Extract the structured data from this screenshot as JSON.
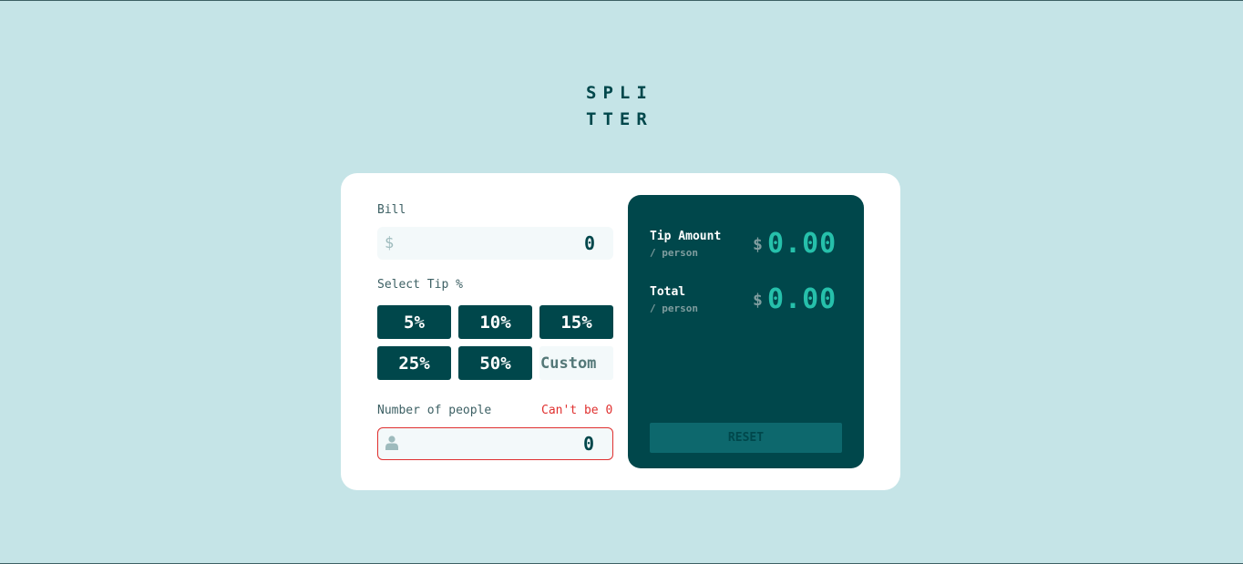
{
  "logo": {
    "line1": "SPLI",
    "line2": "TTER"
  },
  "bill": {
    "label": "Bill",
    "currency_symbol": "$",
    "value": "0"
  },
  "tip": {
    "label": "Select Tip %",
    "options": [
      "5%",
      "10%",
      "15%",
      "25%",
      "50%"
    ],
    "custom_placeholder": "Custom"
  },
  "people": {
    "label": "Number of people",
    "error": "Can't be 0",
    "value": "0",
    "icon": "person-icon"
  },
  "results": {
    "tip_amount": {
      "title": "Tip Amount",
      "sub": "/ person",
      "currency": "$",
      "value": "0.00"
    },
    "total": {
      "title": "Total",
      "sub": "/ person",
      "currency": "$",
      "value": "0.00"
    },
    "reset_label": "RESET"
  },
  "colors": {
    "background": "#c5e4e7",
    "dark_cyan": "#00474b",
    "strong_cyan": "#26c0ab",
    "error": "#e0302f"
  }
}
